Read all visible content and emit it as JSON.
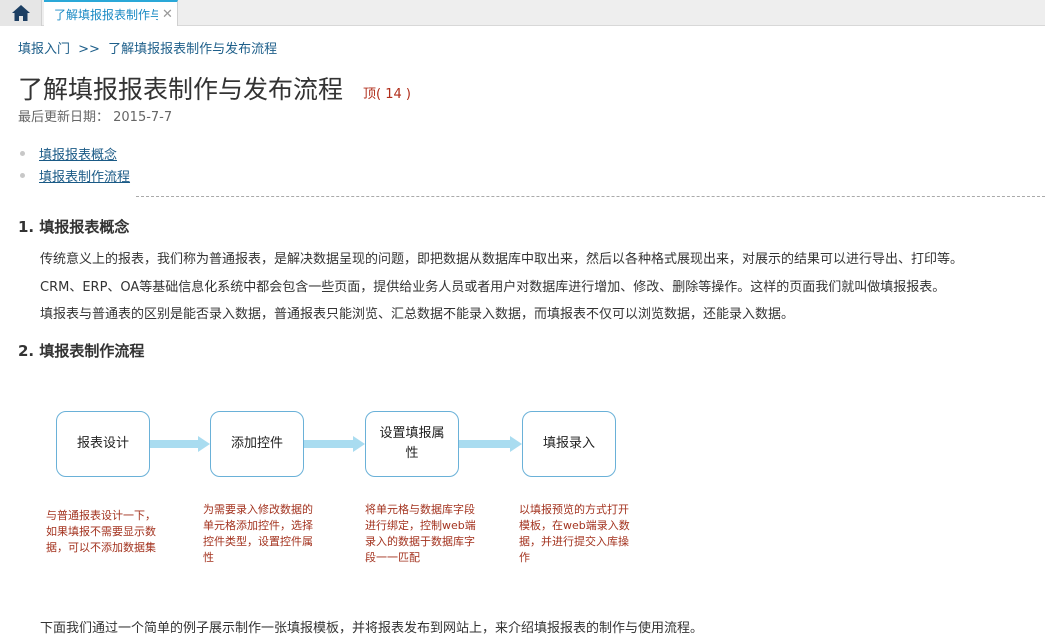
{
  "tabbar": {
    "home_icon": "home-icon",
    "tab_label": "了解填报报表制作与",
    "close_glyph": "✕"
  },
  "breadcrumb": {
    "root": "填报入门",
    "sep": ">>",
    "current": "了解填报报表制作与发布流程"
  },
  "title": "了解填报报表制作与发布流程",
  "vote": "顶( 14 )",
  "updated": "最后更新日期： 2015-7-7",
  "toc": [
    {
      "label": "填报报表概念"
    },
    {
      "label": "填报表制作流程"
    }
  ],
  "section1": {
    "heading": "1. 填报报表概念",
    "paragraphs": [
      "传统意义上的报表，我们称为普通报表，是解决数据呈现的问题，即把数据从数据库中取出来，然后以各种格式展现出来，对展示的结果可以进行导出、打印等。",
      "CRM、ERP、OA等基础信息化系统中都会包含一些页面，提供给业务人员或者用户对数据库进行增加、修改、删除等操作。这样的页面我们就叫做填报报表。",
      "填报表与普通表的区别是能否录入数据，普通报表只能浏览、汇总数据不能录入数据，而填报表不仅可以浏览数据，还能录入数据。"
    ]
  },
  "section2": {
    "heading": "2. 填报表制作流程"
  },
  "flow": {
    "steps": [
      {
        "label": "报表设计",
        "desc": "与普通报表设计一下，如果填报不需要显示数据，可以不添加数据集"
      },
      {
        "label": "添加控件",
        "desc": "为需要录入修改数据的单元格添加控件，选择控件类型，设置控件属性"
      },
      {
        "label": "设置填报属性",
        "desc": "将单元格与数据库字段进行绑定，控制web端录入的数据于数据库字段一一匹配"
      },
      {
        "label": "填报录入",
        "desc": "以填报预览的方式打开模板，在web端录入数据，并进行提交入库操作"
      }
    ]
  },
  "footer": "下面我们通过一个简单的例子展示制作一张填报模板，并将报表发布到网站上，来介绍填报报表的制作与使用流程。",
  "colors": {
    "accent": "#2aa8d8",
    "link": "#1a5a86",
    "desc": "#a3331f",
    "box_border": "#6ab1d8",
    "arrow": "#a9dcf0"
  }
}
